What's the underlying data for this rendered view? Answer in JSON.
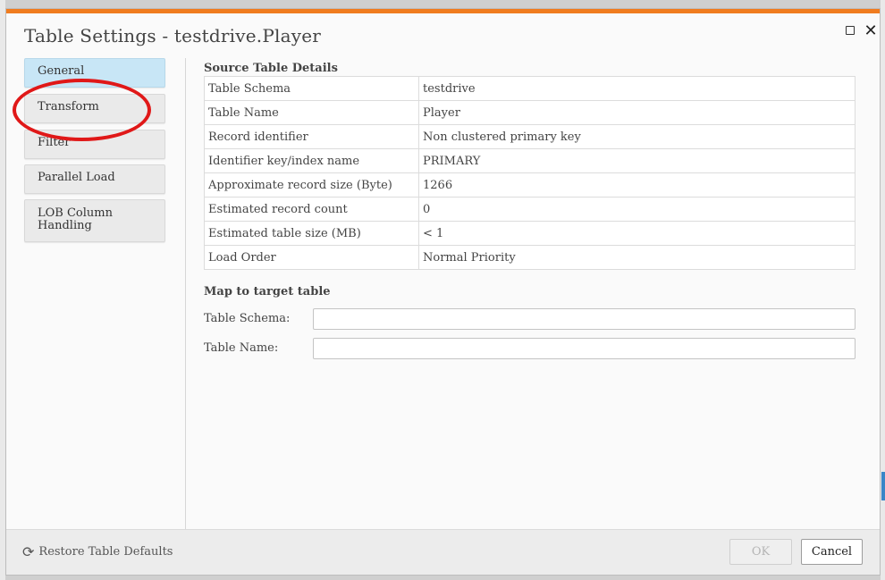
{
  "dialog": {
    "title": "Table Settings - testdrive.Player",
    "accent_color": "#f07c1f"
  },
  "sidebar": {
    "items": [
      {
        "label": "General",
        "active": true
      },
      {
        "label": "Transform",
        "active": false
      },
      {
        "label": "Filter",
        "active": false
      },
      {
        "label": "Parallel Load",
        "active": false
      },
      {
        "label": "LOB Column Handling",
        "active": false
      }
    ]
  },
  "source": {
    "title": "Source Table Details",
    "rows": [
      {
        "key": "Table Schema",
        "value": "testdrive"
      },
      {
        "key": "Table Name",
        "value": "Player"
      },
      {
        "key": "Record identifier",
        "value": "Non clustered primary key"
      },
      {
        "key": "Identifier key/index name",
        "value": "PRIMARY"
      },
      {
        "key": "Approximate record size (Byte)",
        "value": "1266"
      },
      {
        "key": "Estimated record count",
        "value": "0"
      },
      {
        "key": "Estimated table size (MB)",
        "value": "< 1"
      },
      {
        "key": "Load Order",
        "value": "Normal Priority"
      }
    ]
  },
  "target": {
    "title": "Map to target table",
    "schema_label": "Table Schema:",
    "schema_value": "",
    "name_label": "Table Name:",
    "name_value": ""
  },
  "footer": {
    "restore_label": "Restore Table Defaults",
    "ok_label": "OK",
    "cancel_label": "Cancel"
  },
  "icons": {
    "maximize": "maximize-icon",
    "close": "close-icon",
    "restore": "refresh-icon"
  },
  "annotation_color": "#e01818"
}
